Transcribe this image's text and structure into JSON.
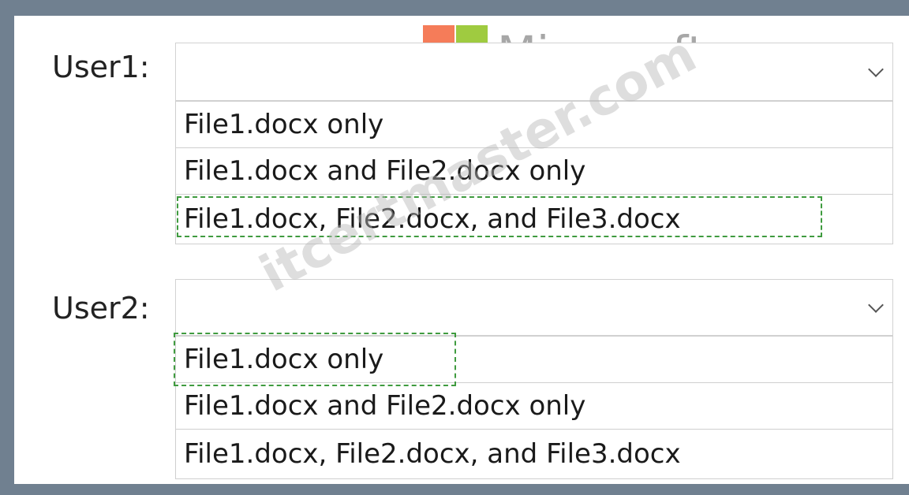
{
  "branding": {
    "logo_text": "Microsoft",
    "logo_colors": [
      "#f25022",
      "#7fba00",
      "#00a4ef",
      "#ffb900"
    ],
    "watermark_text": "itcertmaster.com"
  },
  "questions": [
    {
      "label": "User1:",
      "selected_value": "",
      "options": [
        "File1.docx only",
        "File1.docx and File2.docx only",
        "File1.docx, File2.docx, and File3.docx"
      ],
      "highlighted_option_index": 2
    },
    {
      "label": "User2:",
      "selected_value": "",
      "options": [
        "File1.docx only",
        "File1.docx and File2.docx only",
        "File1.docx, File2.docx, and File3.docx"
      ],
      "highlighted_option_index": 0
    }
  ],
  "colors": {
    "background": "#708090",
    "answer_marker": "#3f9b3f"
  }
}
